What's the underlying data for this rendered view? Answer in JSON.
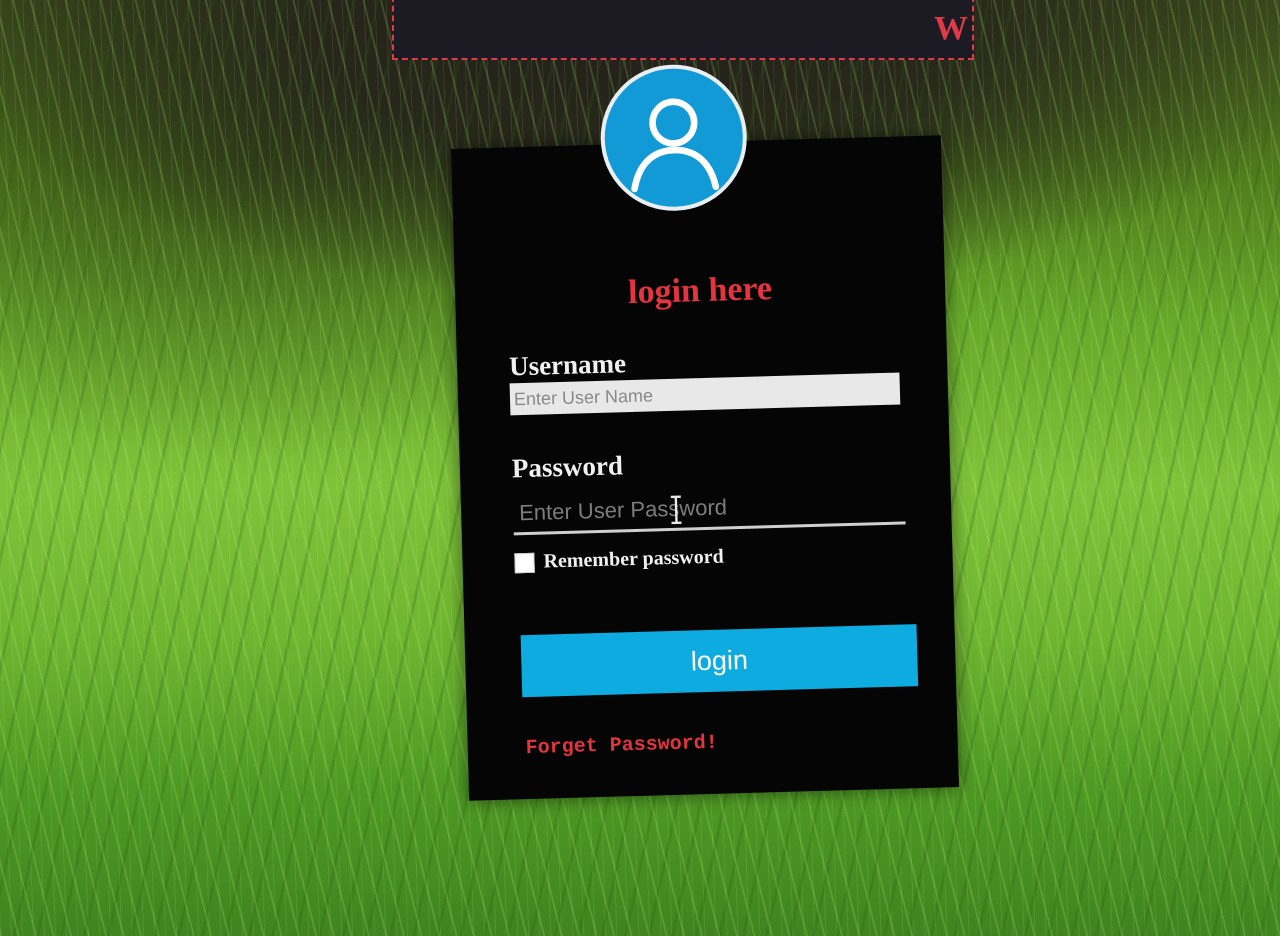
{
  "background": {
    "description_icon": "grass-wallpaper"
  },
  "banner": {
    "text": "W",
    "accent_color": "#e03a48"
  },
  "login": {
    "avatar_icon": "user-avatar-icon",
    "title": "login here",
    "username_label": "Username",
    "username_placeholder": "Enter User Name",
    "username_value": "",
    "password_label": "Password",
    "password_placeholder": "Enter User Password",
    "password_value": "",
    "remember_label": "Remember password",
    "remember_checked": false,
    "submit_label": "login",
    "forgot_link": "Forget Password!"
  },
  "colors": {
    "panel": "#050506",
    "title_red": "#e3343f",
    "button_blue": "#0eabe0",
    "avatar_blue": "#129ad6"
  }
}
